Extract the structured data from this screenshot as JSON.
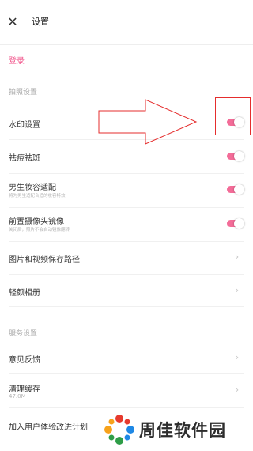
{
  "header": {
    "close_icon": "close-icon",
    "title": "设置"
  },
  "login": {
    "label": "登录",
    "color": "#f15289"
  },
  "sections": {
    "photo": "拍照设置",
    "service": "服务设置"
  },
  "photo_items": [
    {
      "title": "水印设置",
      "subtitle": "",
      "control": "toggle",
      "on": true
    },
    {
      "title": "祛痘祛斑",
      "subtitle": "",
      "control": "toggle",
      "on": true
    },
    {
      "title": "男生妆容适配",
      "subtitle": "将为男生适配合适的妆容特效",
      "control": "toggle",
      "on": true
    },
    {
      "title": "前置摄像头镜像",
      "subtitle": "关闭后，照片不会自动镜像翻转",
      "control": "toggle",
      "on": true
    },
    {
      "title": "图片和视频保存路径",
      "subtitle": "",
      "control": "chevron"
    },
    {
      "title": "轻颜相册",
      "subtitle": "",
      "control": "chevron"
    }
  ],
  "service_items": [
    {
      "title": "意见反馈",
      "subtitle": "",
      "control": "chevron"
    },
    {
      "title": "清理缓存",
      "subtitle": "47.0M",
      "control": "chevron"
    },
    {
      "title": "加入用户体验改进计划",
      "subtitle": "",
      "control": "none"
    }
  ],
  "annotation": {
    "color": "#e52d2d"
  },
  "watermark": {
    "text": "周佳软件园"
  },
  "colors": {
    "accent": "#f36c98",
    "divider": "#f0f0f0",
    "muted": "#a9a9a9"
  }
}
